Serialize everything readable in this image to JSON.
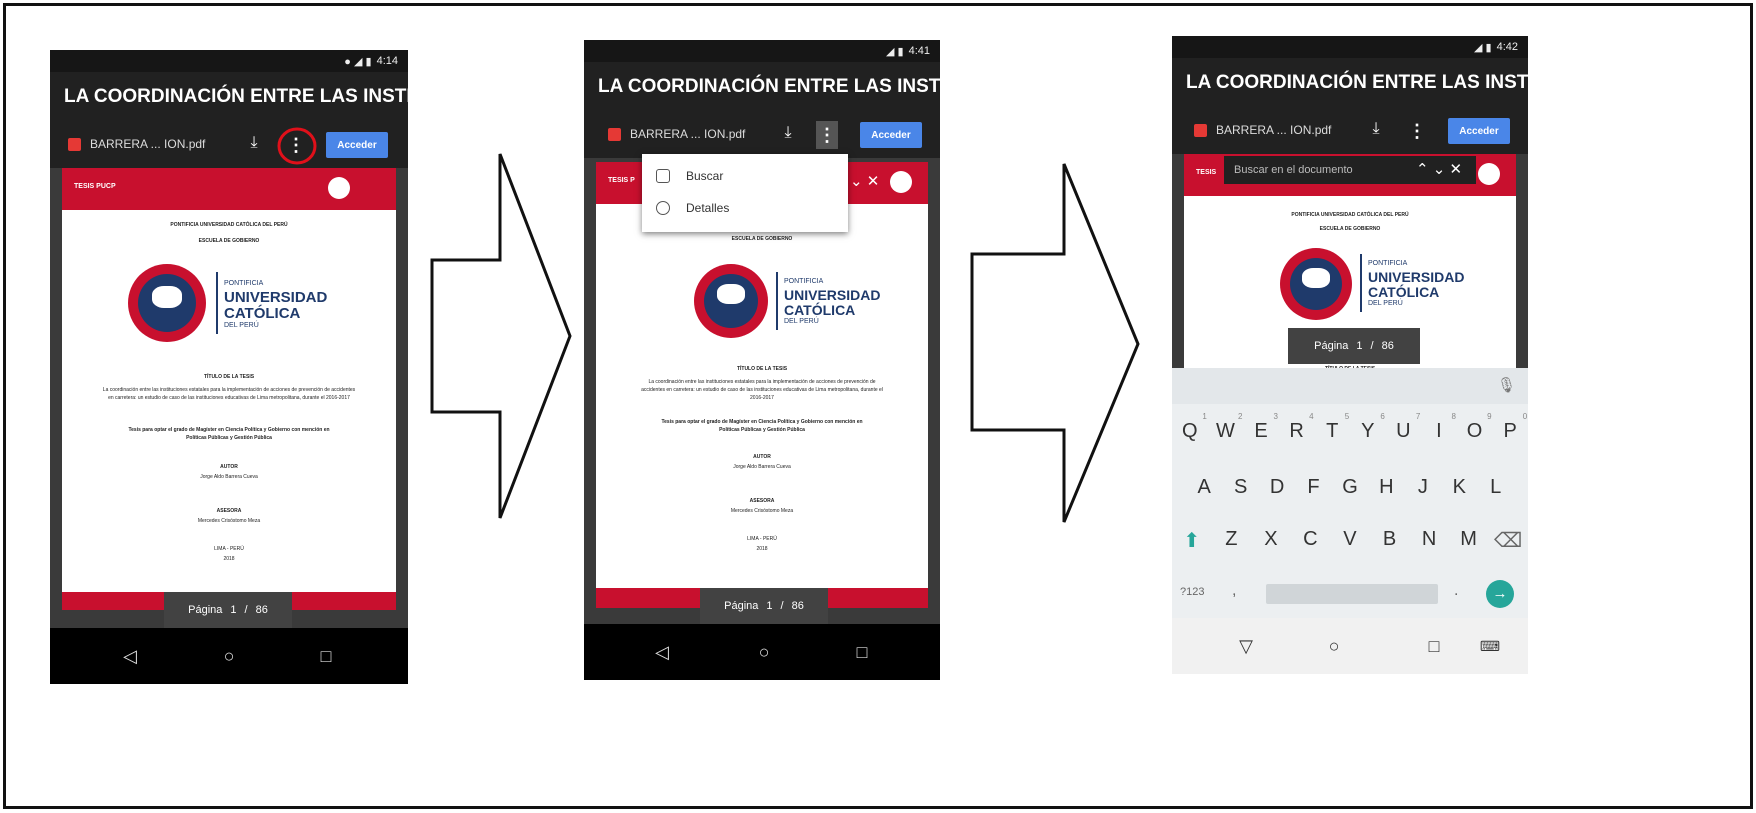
{
  "phones": [
    {
      "status_time": "4:14",
      "title": "LA COORDINACIÓN ENTRE LAS INSTIT...",
      "pdf_name": "BARRERA ... ION.pdf",
      "access_label": "Acceder",
      "page_header": "TESIS PUCP",
      "doc": {
        "university": "PONTIFICIA UNIVERSIDAD CATÓLICA DEL PERÚ",
        "school": "ESCUELA DE GOBIERNO",
        "logo_top": "PONTIFICIA",
        "logo_mid1": "UNIVERSIDAD",
        "logo_mid2": "CATÓLICA",
        "logo_bot": "DEL PERÚ",
        "thesis_title_label": "TÍTULO DE LA TESIS",
        "thesis_title": "La coordinación entre las instituciones estatales para la implementación de acciones de prevención de accidentes en carretera: un estudio de caso de las instituciones educativas de Lima metropolitana, durante el 2016-2017",
        "degree": "Tesis para optar el grado de Magíster en Ciencia Política y Gobierno con mención en Políticas Públicas y Gestión Pública",
        "author_label": "AUTOR",
        "author": "Jorge Aldo Barrera Cueva",
        "advisor_label": "ASESORA",
        "advisor": "Mercedes Crisóstomo Meza",
        "city": "LIMA - PERÚ",
        "year": "2018"
      },
      "page_label": "Página",
      "page_current": "1",
      "page_sep": "/",
      "page_total": "86"
    },
    {
      "status_time": "4:41",
      "title": "LA COORDINACIÓN ENTRE LAS INSTIT...",
      "pdf_name": "BARRERA ... ION.pdf",
      "access_label": "Acceder",
      "page_header": "TESIS P",
      "menu": [
        "Buscar",
        "Detalles"
      ],
      "page_label": "Página",
      "page_current": "1",
      "page_sep": "/",
      "page_total": "86"
    },
    {
      "status_time": "4:42",
      "title": "LA COORDINACIÓN ENTRE LAS INSTIT...",
      "pdf_name": "BARRERA ... ION.pdf",
      "access_label": "Acceder",
      "page_header": "TESIS",
      "search_placeholder": "Buscar en el documento",
      "page_label": "Página",
      "page_current": "1",
      "page_sep": "/",
      "page_total": "86",
      "keyboard": {
        "row1": [
          "Q",
          "W",
          "E",
          "R",
          "T",
          "Y",
          "U",
          "I",
          "O",
          "P"
        ],
        "row1_digits": [
          "1",
          "2",
          "3",
          "4",
          "5",
          "6",
          "7",
          "8",
          "9",
          "0"
        ],
        "row2": [
          "A",
          "S",
          "D",
          "F",
          "G",
          "H",
          "J",
          "K",
          "L"
        ],
        "row3": [
          "Z",
          "X",
          "C",
          "V",
          "B",
          "N",
          "M"
        ],
        "symbols_key": "?123",
        "comma_key": ",",
        "period_key": "."
      }
    }
  ],
  "colors": {
    "pucp_red": "#c8102e",
    "pucp_blue": "#1f3a6b",
    "accent_blue": "#4a86e8",
    "highlight_circle": "#e0101a",
    "go_key": "#26a69a"
  }
}
